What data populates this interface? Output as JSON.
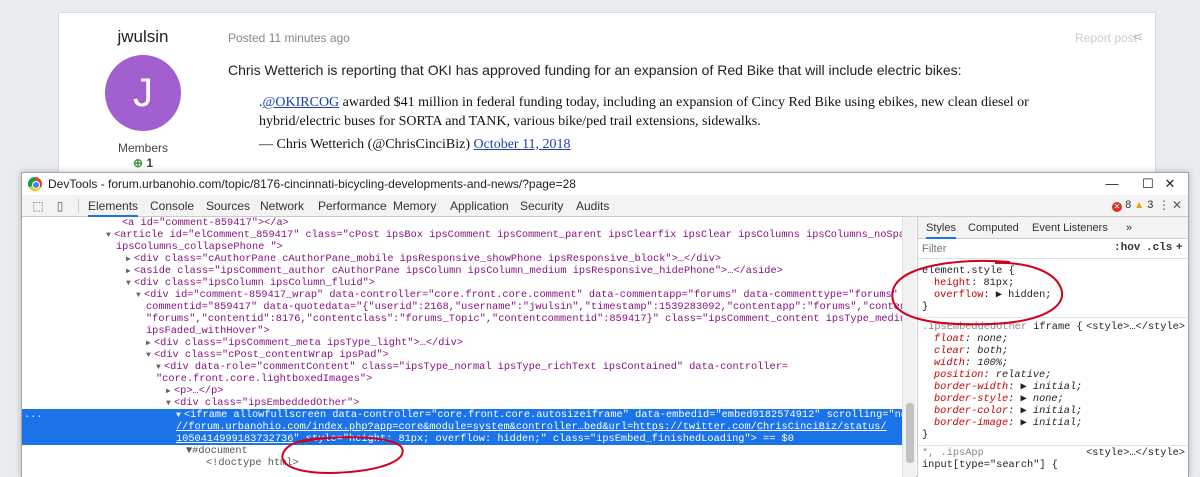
{
  "post": {
    "author_name": "jwulsin",
    "avatar_letter": "J",
    "avatar_color": "#a25fd0",
    "group": "Members",
    "reputation_icon": "plus-circle-icon",
    "reputation": "1",
    "posted": "Posted 11 minutes ago",
    "report_label": "Report post",
    "share_icon": "share-icon",
    "body": "Chris Wetterich is reporting that OKI has approved funding for an expansion of Red Bike that will include electric bikes:",
    "tweet_prefix": ".",
    "tweet_handle": "@OKIRCOG",
    "tweet_text": " awarded $41 million in federal funding today, including an expansion of Cincy Red Bike using ebikes, new clean diesel or hybrid/electric buses for SORTA and TANK, various bike/ped trail extensions, sidewalks.",
    "tweet_author": "— Chris Wetterich (@ChrisCinciBiz) ",
    "tweet_date": "October 11, 2018"
  },
  "devtools": {
    "title": "DevTools - forum.urbanohio.com/topic/8176-cincinnati-bicycling-developments-and-news/?page=28",
    "window_controls": {
      "minimize": "—",
      "maximize": "☐",
      "close": "✕"
    },
    "tabs": [
      "Elements",
      "Console",
      "Sources",
      "Network",
      "Performance",
      "Memory",
      "Application",
      "Security",
      "Audits"
    ],
    "active_tab": "Elements",
    "errors": "8",
    "warnings": "3",
    "accent_color": "#1a73e8"
  },
  "dom": {
    "line0": "<a id=\"comment-859417\"></a>",
    "line1_a": "<article id=\"elComment_859417\" class=\"cPost ipsBox  ipsComment  ipsComment_parent ipsClearfix ipsClear ipsColumns ipsColumns_noSpacing",
    "line1_b": "ipsColumns_collapsePhone  \">",
    "line2": "<div class=\"cAuthorPane cAuthorPane_mobile ipsResponsive_showPhone ipsResponsive_block\">…</div>",
    "line3": "<aside class=\"ipsComment_author cAuthorPane ipsColumn ipsColumn_medium ipsResponsive_hidePhone\">…</aside>",
    "line4": "<div class=\"ipsColumn ipsColumn_fluid\">",
    "line5_a": "<div id=\"comment-859417_wrap\" data-controller=\"core.front.core.comment\" data-commentapp=\"forums\" data-commenttype=\"forums\" data-",
    "line5_b": "commentid=\"859417\" data-quotedata=\"{\"userid\":2168,\"username\":\"jwulsin\",\"timestamp\":1539283092,\"contentapp\":\"forums\",\"contenttype\":",
    "line5_c": "\"forums\",\"contentid\":8176,\"contentclass\":\"forums_Topic\",\"contentcommentid\":859417}\" class=\"ipsComment_content ipsType_medium",
    "line5_d": "ipsFaded_withHover\">",
    "line6": "<div class=\"ipsComment_meta ipsType_light\">…</div>",
    "line7": "<div class=\"cPost_contentWrap ipsPad\">",
    "line8_a": "<div data-role=\"commentContent\" class=\"ipsType_normal ipsType_richText ipsContained\" data-controller=",
    "line8_b": "\"core.front.core.lightboxedImages\">",
    "line9": "<p>…</p>",
    "line10": "<div class=\"ipsEmbeddedOther\">",
    "sel_a": "<iframe allowfullscreen data-controller=\"core.front.core.autosizeiframe\" data-embedid=\"embed9182574912\" scrolling=\"no\" src=\"https:",
    "sel_b": "//forum.urbanohio.com/index.php?app=core&module=system&controller…bed&url=https://twitter.com/ChrisCinciBiz/status/",
    "sel_c_url": "1050414999183732736",
    "sel_c_rest": "\" style=\"height: 81px; overflow: hidden;\" class=\"ipsEmbed_finishedLoading\"> == $0",
    "line12": "▼#document",
    "line13": "<!doctype html>",
    "dots": "..."
  },
  "styles_panel": {
    "tabs": [
      "Styles",
      "Computed",
      "Event Listeners"
    ],
    "more": "»",
    "filter_placeholder": "Filter",
    "hov": ":hov",
    "cls": ".cls",
    "plus": "+",
    "element_style_selector": "element.style {",
    "element_style_props": [
      {
        "name": "height",
        "value": "81px;"
      },
      {
        "name": "overflow",
        "value": "▶ hidden;"
      }
    ],
    "close_brace": "}",
    "rule2_selector_a": ".ipsEmbeddedOther",
    "rule2_selector_b": " iframe {",
    "rule2_origin": "<style>…</style>",
    "rule2_props": [
      {
        "name": "float",
        "value": "none;"
      },
      {
        "name": "clear",
        "value": "both;"
      },
      {
        "name": "width",
        "value": "100%;"
      },
      {
        "name": "position",
        "value": "relative;"
      },
      {
        "name": "border-width",
        "value": "▶ initial;"
      },
      {
        "name": "border-style",
        "value": "▶ none;"
      },
      {
        "name": "border-color",
        "value": "▶ initial;"
      },
      {
        "name": "border-image",
        "value": "▶ initial;"
      }
    ],
    "rule3_selector_a": "*, .ipsApp",
    "rule3_selector_b": "input[type=\"search\"] {",
    "rule3_origin": "<style>…</style>"
  }
}
